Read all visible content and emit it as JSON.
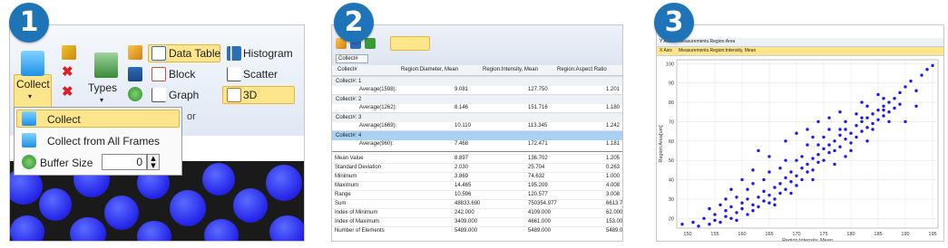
{
  "badges": [
    "1",
    "2",
    "3"
  ],
  "ribbon": {
    "collect_label": "Collect",
    "types_label": "Types",
    "data_table": "Data Table",
    "histogram": "Histogram",
    "block": "Block",
    "scatter": "Scatter",
    "graph": "Graph",
    "threed": "3D",
    "group_partial": "or"
  },
  "collect_menu": {
    "items": [
      "Collect",
      "Collect from All Frames"
    ],
    "buffer_label": "Buffer Size",
    "buffer_value": "0"
  },
  "table": {
    "group_by_chip": "Collect#",
    "columns": [
      "Collect#",
      "Region:Diameter, Mean",
      "Region:Intensity, Mean",
      "Region:Aspect Ratio"
    ],
    "groups": [
      {
        "label": "Collect#: 1",
        "avg_label": "Average(1598):",
        "values": [
          "9.081",
          "127.750",
          "1.201"
        ]
      },
      {
        "label": "Collect#: 2",
        "avg_label": "Average(1262):",
        "values": [
          "8.146",
          "151.716",
          "1.180"
        ]
      },
      {
        "label": "Collect#: 3",
        "avg_label": "Average(1669):",
        "values": [
          "10.110",
          "113.345",
          "1.242"
        ]
      },
      {
        "label": "Collect#: 4",
        "avg_label": "Average(960):",
        "values": [
          "7.468",
          "172.471",
          "1.181"
        ]
      }
    ],
    "stats": [
      {
        "label": "Mean Value",
        "values": [
          "8.897",
          "136.702",
          "1.205"
        ]
      },
      {
        "label": "Standard Deviation",
        "values": [
          "2.030",
          "25.704",
          "0.263"
        ]
      },
      {
        "label": "Minimum",
        "values": [
          "3.869",
          "74.632",
          "1.000"
        ]
      },
      {
        "label": "Maximum",
        "values": [
          "14.465",
          "195.209",
          "4.008"
        ]
      },
      {
        "label": "Range",
        "values": [
          "10.596",
          "120.577",
          "3.008"
        ]
      },
      {
        "label": "Sum",
        "values": [
          "48833.690",
          "750354.977",
          "6613.753"
        ]
      },
      {
        "label": "Index of Minimum",
        "values": [
          "242.000",
          "4109.000",
          "62.000"
        ]
      },
      {
        "label": "Index of Maximum",
        "values": [
          "3409.000",
          "4661.000",
          "153.000"
        ]
      },
      {
        "label": "Number of Elements",
        "values": [
          "5489.000",
          "5489.000",
          "5489.000"
        ]
      }
    ]
  },
  "scatter_panel": {
    "y_selector": "Y Axis",
    "y_value": "Measurements.Region:Area",
    "x_selector": "X Axis",
    "x_value": "Measurements.Region:Intensity, Mean"
  },
  "chart_data": {
    "type": "scatter",
    "xlabel": "Region:Intensity, Mean",
    "ylabel": "Region:Area[um]",
    "xlim": [
      148,
      196
    ],
    "ylim": [
      15,
      102
    ],
    "xticks": [
      150,
      155,
      160,
      165,
      170,
      175,
      180,
      185,
      190,
      195
    ],
    "yticks": [
      20,
      30,
      40,
      50,
      60,
      70,
      80,
      90,
      100
    ],
    "grid": true,
    "series": [
      {
        "color": "#1a1aee",
        "points": [
          [
            149,
            17
          ],
          [
            151,
            18
          ],
          [
            152,
            16
          ],
          [
            153,
            20
          ],
          [
            154,
            17
          ],
          [
            155,
            19
          ],
          [
            155,
            22
          ],
          [
            156,
            18
          ],
          [
            157,
            21
          ],
          [
            157,
            24
          ],
          [
            158,
            20
          ],
          [
            158,
            26
          ],
          [
            159,
            23
          ],
          [
            159,
            19
          ],
          [
            160,
            25
          ],
          [
            160,
            28
          ],
          [
            161,
            22
          ],
          [
            161,
            30
          ],
          [
            162,
            27
          ],
          [
            162,
            24
          ],
          [
            163,
            31
          ],
          [
            163,
            26
          ],
          [
            164,
            29
          ],
          [
            164,
            34
          ],
          [
            165,
            32
          ],
          [
            165,
            28
          ],
          [
            166,
            36
          ],
          [
            166,
            30
          ],
          [
            167,
            38
          ],
          [
            167,
            33
          ],
          [
            168,
            35
          ],
          [
            168,
            41
          ],
          [
            169,
            39
          ],
          [
            169,
            44
          ],
          [
            170,
            42
          ],
          [
            170,
            37
          ],
          [
            171,
            46
          ],
          [
            171,
            40
          ],
          [
            172,
            48
          ],
          [
            172,
            44
          ],
          [
            173,
            51
          ],
          [
            173,
            45
          ],
          [
            174,
            53
          ],
          [
            174,
            49
          ],
          [
            175,
            56
          ],
          [
            175,
            50
          ],
          [
            176,
            58
          ],
          [
            176,
            54
          ],
          [
            177,
            60
          ],
          [
            177,
            55
          ],
          [
            178,
            63
          ],
          [
            178,
            57
          ],
          [
            179,
            61
          ],
          [
            179,
            66
          ],
          [
            180,
            64
          ],
          [
            180,
            59
          ],
          [
            181,
            68
          ],
          [
            181,
            62
          ],
          [
            182,
            70
          ],
          [
            182,
            65
          ],
          [
            183,
            72
          ],
          [
            183,
            67
          ],
          [
            184,
            74
          ],
          [
            184,
            69
          ],
          [
            185,
            76
          ],
          [
            185,
            71
          ],
          [
            186,
            78
          ],
          [
            186,
            73
          ],
          [
            187,
            80
          ],
          [
            187,
            75
          ],
          [
            188,
            82
          ],
          [
            189,
            85
          ],
          [
            189,
            79
          ],
          [
            190,
            88
          ],
          [
            191,
            91
          ],
          [
            192,
            86
          ],
          [
            193,
            94
          ],
          [
            194,
            97
          ],
          [
            195,
            99
          ],
          [
            188,
            77
          ],
          [
            176,
            72
          ],
          [
            172,
            66
          ],
          [
            168,
            60
          ],
          [
            165,
            52
          ],
          [
            162,
            45
          ],
          [
            160,
            40
          ],
          [
            158,
            35
          ],
          [
            163,
            55
          ],
          [
            170,
            64
          ],
          [
            174,
            70
          ],
          [
            178,
            75
          ],
          [
            182,
            80
          ],
          [
            185,
            84
          ],
          [
            180,
            55
          ],
          [
            177,
            48
          ],
          [
            173,
            40
          ],
          [
            169,
            33
          ],
          [
            166,
            27
          ],
          [
            171,
            52
          ],
          [
            175,
            62
          ],
          [
            179,
            70
          ],
          [
            183,
            78
          ],
          [
            186,
            82
          ],
          [
            190,
            70
          ],
          [
            192,
            78
          ],
          [
            167,
            46
          ],
          [
            164,
            40
          ],
          [
            161,
            35
          ],
          [
            157,
            30
          ],
          [
            154,
            25
          ],
          [
            172,
            58
          ],
          [
            176,
            66
          ],
          [
            181,
            74
          ],
          [
            184,
            66
          ],
          [
            187,
            70
          ],
          [
            170,
            50
          ],
          [
            174,
            58
          ],
          [
            178,
            66
          ],
          [
            182,
            72
          ],
          [
            186,
            76
          ],
          [
            179,
            52
          ],
          [
            183,
            60
          ],
          [
            173,
            62
          ],
          [
            168,
            50
          ],
          [
            165,
            44
          ],
          [
            162,
            38
          ],
          [
            159,
            31
          ],
          [
            156,
            27
          ]
        ]
      }
    ]
  }
}
